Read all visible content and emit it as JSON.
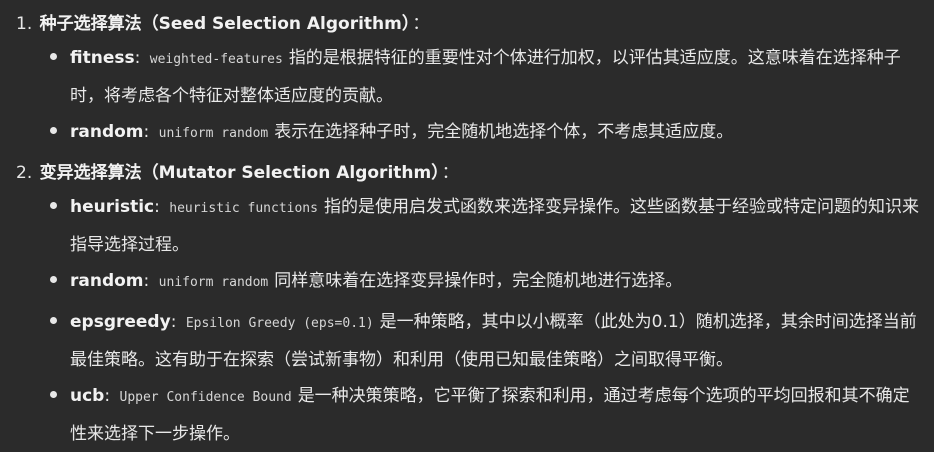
{
  "sections": [
    {
      "number": "1.",
      "title": "种子选择算法（Seed Selection Algorithm）",
      "colon": "：",
      "items": [
        {
          "term": "fitness",
          "sep": ":",
          "code": "weighted-features",
          "desc": "指的是根据特征的重要性对个体进行加权，以评估其适应度。这意味着在选择种子时，将考虑各个特征对整体适应度的贡献。"
        },
        {
          "term": "random",
          "sep": ":",
          "code": "uniform random",
          "desc": "表示在选择种子时，完全随机地选择个体，不考虑其适应度。"
        }
      ]
    },
    {
      "number": "2.",
      "title": "变异选择算法（Mutator Selection Algorithm）",
      "colon": "：",
      "items": [
        {
          "term": "heuristic",
          "sep": ":",
          "code": "heuristic functions",
          "desc": "指的是使用启发式函数来选择变异操作。这些函数基于经验或特定问题的知识来指导选择过程。"
        },
        {
          "term": "random",
          "sep": ":",
          "code": "uniform random",
          "desc": "同样意味着在选择变异操作时，完全随机地进行选择。"
        },
        {
          "term": "epsgreedy",
          "sep": ":",
          "code": "Epsilon Greedy (eps=0.1)",
          "desc": "是一种策略，其中以小概率（此处为0.1）随机选择，其余时间选择当前最佳策略。这有助于在探索（尝试新事物）和利用（使用已知最佳策略）之间取得平衡。"
        },
        {
          "term": "ucb",
          "sep": ":",
          "code": "Upper Confidence Bound",
          "desc": "是一种决策策略，它平衡了探索和利用，通过考虑每个选项的平均回报和其不确定性来选择下一步操作。"
        }
      ]
    }
  ]
}
